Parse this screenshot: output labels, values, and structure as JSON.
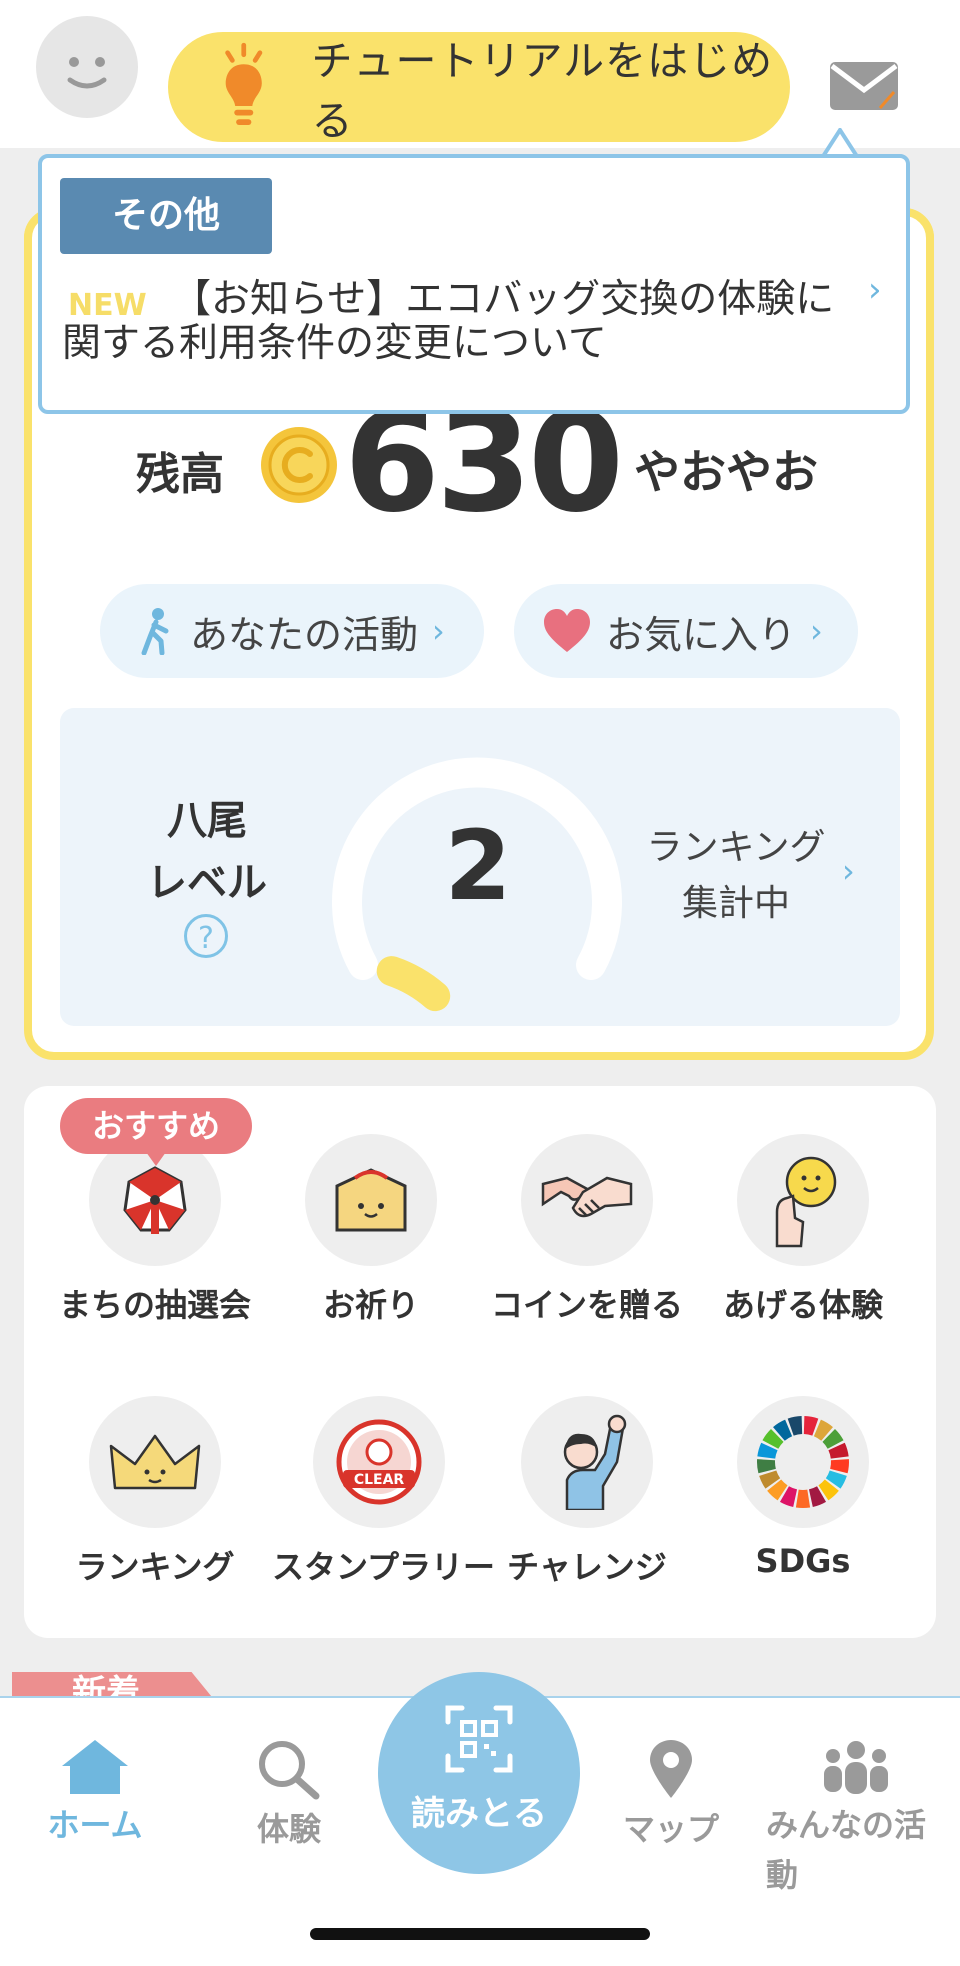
{
  "header": {
    "tutorial_label": "チュートリアルをはじめる"
  },
  "notice": {
    "category": "その他",
    "new_label": "NEW",
    "text": "【お知らせ】エコバッグ交換の体験に関する利用条件の変更について"
  },
  "balance": {
    "label": "残高",
    "value": "630",
    "user_name": "やおやお"
  },
  "links": {
    "activity": "あなたの活動",
    "favorites": "お気に入り"
  },
  "level": {
    "title_line1": "八尾",
    "title_line2": "レベル",
    "help": "?",
    "value": "2",
    "gauge_progress": 0.08,
    "ranking_line1": "ランキング",
    "ranking_line2": "集計中"
  },
  "services": {
    "badge": "おすすめ",
    "items": [
      {
        "label": "まちの抽選会",
        "icon": "lottery-wheel-icon"
      },
      {
        "label": "お祈り",
        "icon": "ema-plaque-icon"
      },
      {
        "label": "コインを贈る",
        "icon": "handshake-icon"
      },
      {
        "label": "あげる体験",
        "icon": "hand-holding-coin-icon"
      },
      {
        "label": "ランキング",
        "icon": "crown-icon"
      },
      {
        "label": "スタンプラリー",
        "icon": "clear-stamp-icon"
      },
      {
        "label": "チャレンジ",
        "icon": "raised-fist-person-icon"
      },
      {
        "label": "SDGs",
        "icon": "sdgs-wheel-icon"
      }
    ],
    "clear_stamp_text": "CLEAR"
  },
  "section_next": {
    "ribbon": "新着"
  },
  "nav": {
    "home": "ホーム",
    "search": "体験",
    "scan": "読みとる",
    "map": "マップ",
    "community": "みんなの活動"
  },
  "colors": {
    "accent_yellow": "#fae26b",
    "accent_blue": "#8ec6e6",
    "tag_blue": "#5a8ab1",
    "badge_pink": "#ea7c80"
  }
}
